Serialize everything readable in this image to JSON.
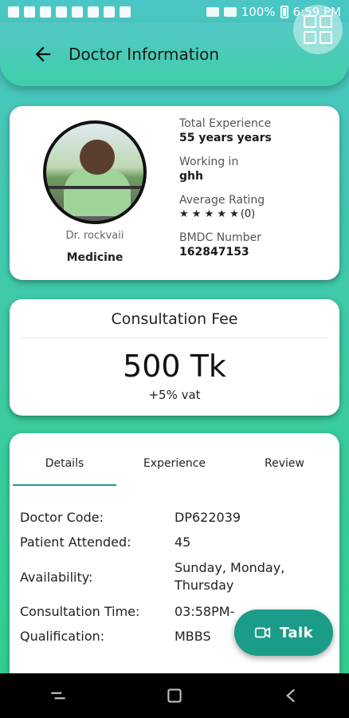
{
  "status": {
    "battery_text": "100%",
    "time": "6:59 PM"
  },
  "app": {
    "title": "Doctor Information"
  },
  "doctor": {
    "name": "Dr. rockvaii",
    "department": "Medicine",
    "experience_label": "Total Experience",
    "experience_value": "55 years years",
    "working_label": "Working in",
    "working_value": "ghh",
    "rating_label": "Average Rating",
    "rating_stars": "★ ★ ★ ★ ★",
    "rating_count": "(0)",
    "bmdc_label": "BMDC Number",
    "bmdc_value": "162847153"
  },
  "fee": {
    "title": "Consultation Fee",
    "amount": "500 Tk",
    "vat": "+5% vat"
  },
  "tabs": [
    "Details",
    "Experience",
    "Review"
  ],
  "details": [
    {
      "key": "Doctor Code:",
      "value": "DP622039"
    },
    {
      "key": "Patient Attended:",
      "value": "45"
    },
    {
      "key": "Availability:",
      "value": "Sunday, Monday, Thursday"
    },
    {
      "key": "Consultation Time:",
      "value": "03:58PM-"
    },
    {
      "key": "Qualification:",
      "value": "MBBS"
    }
  ],
  "fab": {
    "label": "Talk"
  }
}
